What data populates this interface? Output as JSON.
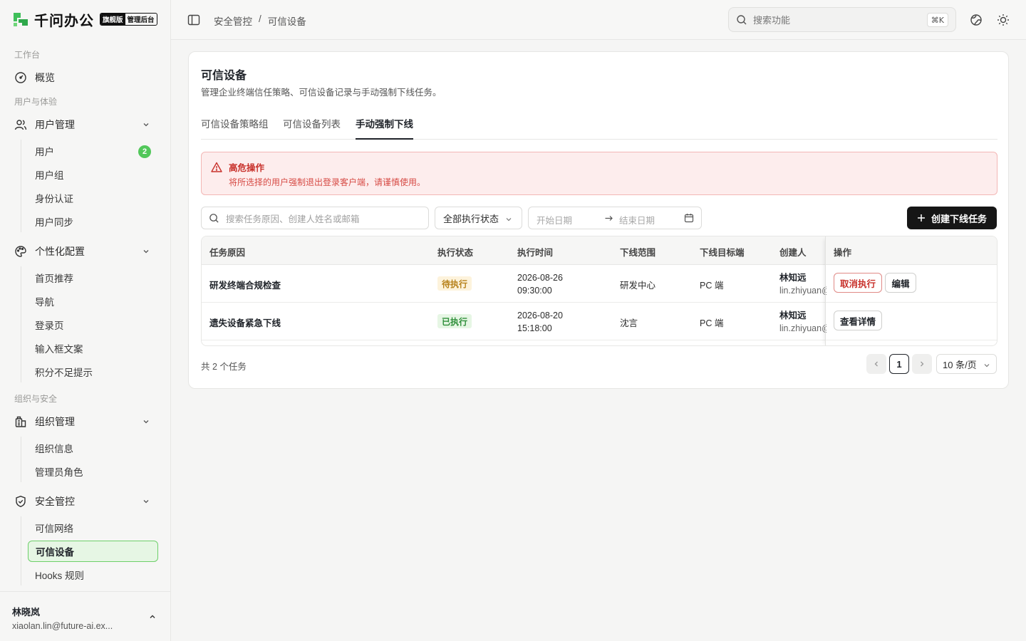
{
  "app": {
    "name": "千问办公",
    "badge_edition": "旗舰版",
    "badge_console": "管理后台"
  },
  "sidebar": {
    "sections": {
      "workspace": "工作台",
      "users_exp": "用户与体验",
      "org_security": "组织与安全"
    },
    "overview": "概览",
    "user_mgmt": {
      "label": "用户管理",
      "items": [
        {
          "label": "用户",
          "badge": "2"
        },
        {
          "label": "用户组"
        },
        {
          "label": "身份认证"
        },
        {
          "label": "用户同步"
        }
      ]
    },
    "personalize": {
      "label": "个性化配置",
      "items": [
        {
          "label": "首页推荐"
        },
        {
          "label": "导航"
        },
        {
          "label": "登录页"
        },
        {
          "label": "输入框文案"
        },
        {
          "label": "积分不足提示"
        }
      ]
    },
    "org_mgmt": {
      "label": "组织管理",
      "items": [
        {
          "label": "组织信息"
        },
        {
          "label": "管理员角色"
        }
      ]
    },
    "security": {
      "label": "安全管控",
      "items": [
        {
          "label": "可信网络"
        },
        {
          "label": "可信设备"
        },
        {
          "label": "Hooks 规则"
        }
      ]
    },
    "user": {
      "name": "林晓岚",
      "email": "xiaolan.lin@future-ai.ex..."
    }
  },
  "header": {
    "breadcrumb": [
      "安全管控",
      "/",
      "可信设备"
    ],
    "search_placeholder": "搜索功能",
    "shortcut": "⌘K"
  },
  "page": {
    "title": "可信设备",
    "description": "管理企业终端信任策略、可信设备记录与手动强制下线任务。",
    "tabs": [
      "可信设备策略组",
      "可信设备列表",
      "手动强制下线"
    ],
    "alert": {
      "title": "高危操作",
      "desc": "将所选择的用户强制退出登录客户端，请谨慎使用。"
    },
    "filters": {
      "search_placeholder": "搜索任务原因、创建人姓名或邮箱",
      "status": "全部执行状态",
      "start_date": "开始日期",
      "end_date": "结束日期"
    },
    "create_button": "创建下线任务",
    "table": {
      "columns": [
        "任务原因",
        "执行状态",
        "执行时间",
        "下线范围",
        "下线目标端",
        "创建人",
        "操作"
      ],
      "rows": [
        {
          "reason": "研发终端合规检查",
          "status": "待执行",
          "date": "2026-08-26",
          "time": "09:30:00",
          "scope": "研发中心",
          "target": "PC 端",
          "creator_name": "林知远",
          "creator_email": "lin.zhiyuan@",
          "actions": [
            "取消执行",
            "编辑"
          ]
        },
        {
          "reason": "遗失设备紧急下线",
          "status": "已执行",
          "date": "2026-08-20",
          "time": "15:18:00",
          "scope": "沈言",
          "target": "PC 端",
          "creator_name": "林知远",
          "creator_email": "lin.zhiyuan@",
          "actions": [
            "查看详情"
          ]
        }
      ]
    },
    "footer": {
      "total": "共 2 个任务",
      "current_page": "1",
      "page_size": "10 条/页"
    }
  },
  "colors": {
    "brand_green": "#52c75a",
    "danger": "#c8312b",
    "dark_button": "#161616"
  }
}
